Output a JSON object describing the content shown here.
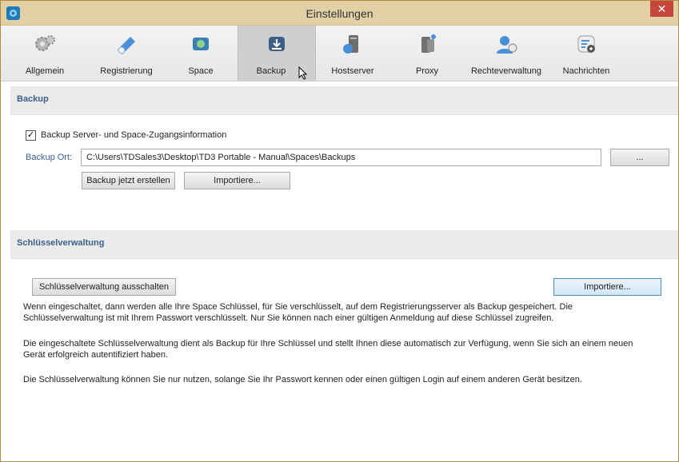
{
  "window": {
    "title": "Einstellungen",
    "close_glyph": "✕"
  },
  "tabs": [
    {
      "label": "Allgemein",
      "icon": "gears-icon"
    },
    {
      "label": "Registrierung",
      "icon": "register-icon"
    },
    {
      "label": "Space",
      "icon": "space-icon"
    },
    {
      "label": "Backup",
      "icon": "backup-icon",
      "active": true
    },
    {
      "label": "Hostserver",
      "icon": "hostserver-icon"
    },
    {
      "label": "Proxy",
      "icon": "proxy-icon"
    },
    {
      "label": "Rechteverwaltung",
      "icon": "rights-icon"
    },
    {
      "label": "Nachrichten",
      "icon": "messages-icon"
    }
  ],
  "backup": {
    "heading": "Backup",
    "checkbox_label": "Backup Server- und Space-Zugangsinformation",
    "checkbox_checked": true,
    "location_label": "Backup Ort:",
    "location_value": "C:\\Users\\TDSales3\\Desktop\\TD3 Portable - Manual\\Spaces\\Backups",
    "browse_label": "...",
    "create_label": "Backup jetzt erstellen",
    "import_label": "Importiere..."
  },
  "keys": {
    "heading": "Schlüsselverwaltung",
    "disable_label": "Schlüsselverwaltung ausschalten",
    "import_label": "Importiere...",
    "paragraph1": "Wenn eingeschaltet, dann werden alle Ihre Space Schlüssel, für Sie verschlüsselt, auf dem Registrierungsserver als Backup gespeichert. Die Schlüsselverwaltung ist mit Ihrem Passwort verschlüsselt. Nur Sie können nach einer gültigen Anmeldung auf diese Schlüssel zugreifen.",
    "paragraph2": "Die eingeschaltete Schlüsselverwaltung dient als Backup für Ihre Schlüssel und stellt Ihnen diese automatisch zur Verfügung, wenn Sie sich an einem neuen Gerät erfolgreich autentifiziert haben.",
    "paragraph3": "Die Schlüsselverwaltung können Sie nur nutzen, solange Sie Ihr Passwort kennen oder einen gültigen Login auf einem anderen Gerät besitzen."
  }
}
